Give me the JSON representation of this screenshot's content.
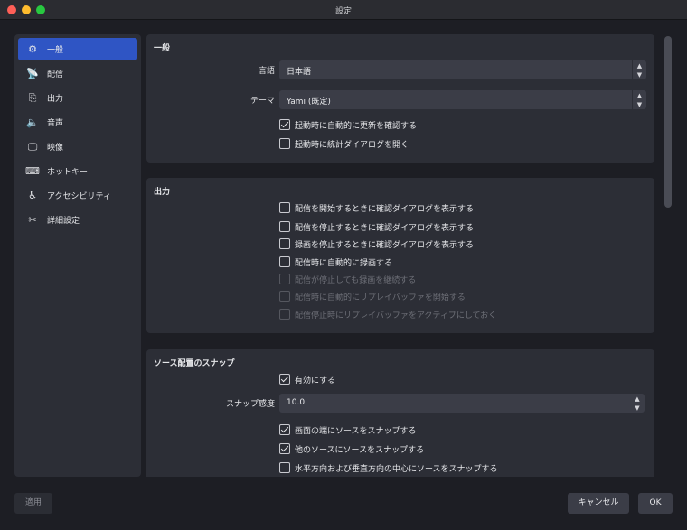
{
  "window": {
    "title": "設定"
  },
  "sidebar": {
    "items": [
      {
        "label": "一般",
        "icon": "gear-icon",
        "glyph": "⚙"
      },
      {
        "label": "配信",
        "icon": "broadcast-icon",
        "glyph": "📡"
      },
      {
        "label": "出力",
        "icon": "output-icon",
        "glyph": "⎘"
      },
      {
        "label": "音声",
        "icon": "speaker-icon",
        "glyph": "🔈"
      },
      {
        "label": "映像",
        "icon": "monitor-icon",
        "glyph": "🖵"
      },
      {
        "label": "ホットキー",
        "icon": "keyboard-icon",
        "glyph": "⌨"
      },
      {
        "label": "アクセシビリティ",
        "icon": "accessibility-icon",
        "glyph": "♿"
      },
      {
        "label": "詳細設定",
        "icon": "tools-icon",
        "glyph": "✂"
      }
    ],
    "active_index": 0
  },
  "general": {
    "title": "一般",
    "language_label": "言語",
    "language_value": "日本語",
    "theme_label": "テーマ",
    "theme_value": "Yami (既定)",
    "check_updates_label": "起動時に自動的に更新を確認する",
    "check_updates_checked": true,
    "stats_label": "起動時に統計ダイアログを開く",
    "stats_checked": false
  },
  "output": {
    "title": "出力",
    "items": [
      {
        "label": "配信を開始するときに確認ダイアログを表示する",
        "checked": false,
        "enabled": true
      },
      {
        "label": "配信を停止するときに確認ダイアログを表示する",
        "checked": false,
        "enabled": true
      },
      {
        "label": "録画を停止するときに確認ダイアログを表示する",
        "checked": false,
        "enabled": true
      },
      {
        "label": "配信時に自動的に録画する",
        "checked": false,
        "enabled": true
      },
      {
        "label": "配信が停止しても録画を継続する",
        "checked": false,
        "enabled": false
      },
      {
        "label": "配信時に自動的にリプレイバッファを開始する",
        "checked": false,
        "enabled": false
      },
      {
        "label": "配信停止時にリプレイバッファをアクティブにしておく",
        "checked": false,
        "enabled": false
      }
    ]
  },
  "snap": {
    "title": "ソース配置のスナップ",
    "enable_label": "有効にする",
    "enable_checked": true,
    "sensitivity_label": "スナップ感度",
    "sensitivity_value": "10.0",
    "items": [
      {
        "label": "画面の端にソースをスナップする",
        "checked": true
      },
      {
        "label": "他のソースにソースをスナップする",
        "checked": true
      },
      {
        "label": "水平方向および垂直方向の中心にソースをスナップする",
        "checked": false
      }
    ]
  },
  "footer": {
    "apply_label": "適用",
    "cancel_label": "キャンセル",
    "ok_label": "OK"
  }
}
